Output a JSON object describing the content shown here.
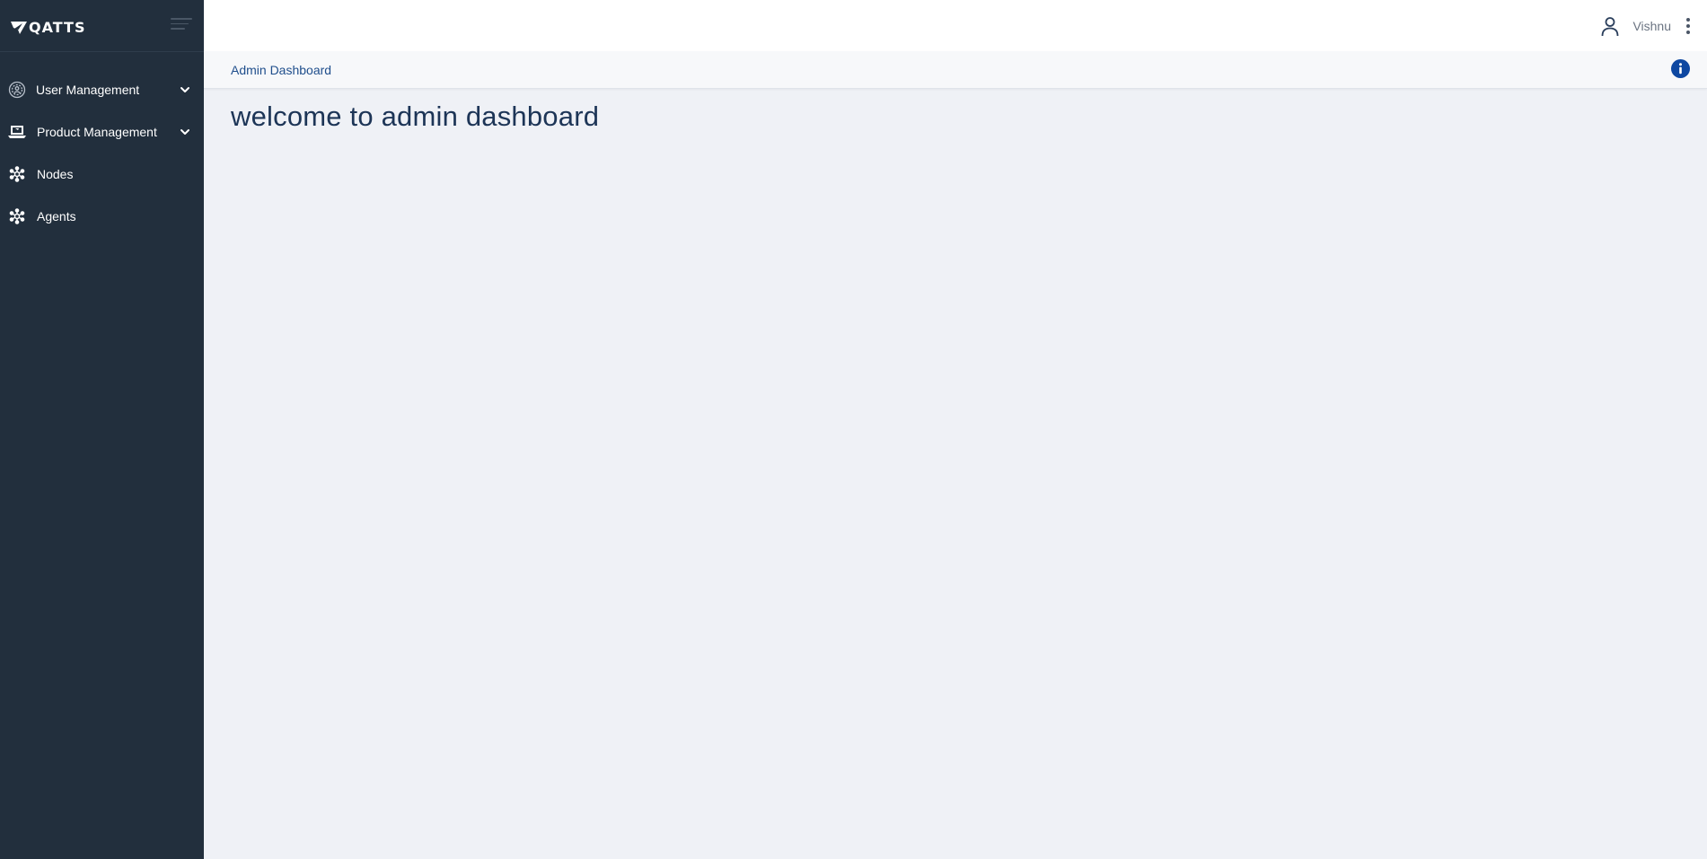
{
  "brand": {
    "name": "QATTS"
  },
  "sidebar": {
    "items": [
      {
        "label": "User Management",
        "icon": "user-gear-icon",
        "expandable": true
      },
      {
        "label": "Product Management",
        "icon": "laptop-icon",
        "expandable": true
      },
      {
        "label": "Nodes",
        "icon": "network-icon",
        "expandable": false
      },
      {
        "label": "Agents",
        "icon": "network-icon",
        "expandable": false
      }
    ]
  },
  "header": {
    "user_name": "Vishnu"
  },
  "breadcrumb": {
    "current": "Admin Dashboard"
  },
  "main": {
    "title": "welcome to admin dashboard"
  },
  "colors": {
    "sidebar_bg": "#222f3d",
    "content_bg": "#eff1f6",
    "accent": "#0d47a1",
    "title": "#1d3557"
  }
}
